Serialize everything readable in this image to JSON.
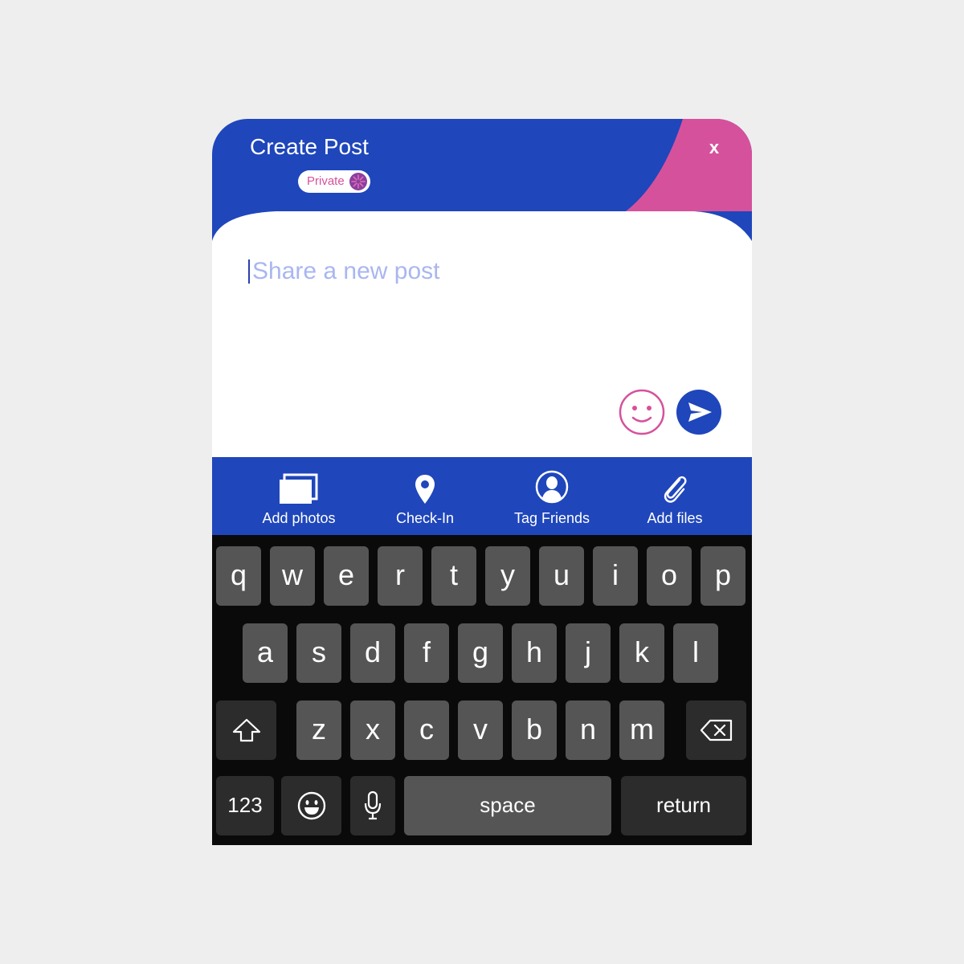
{
  "header": {
    "title": "Create Post",
    "close_label": "x",
    "privacy_label": "Private"
  },
  "composer": {
    "placeholder": "Share a new post",
    "value": ""
  },
  "toolbar": {
    "items": [
      {
        "label": "Add photos",
        "icon": "photos-icon"
      },
      {
        "label": "Check-In",
        "icon": "location-pin-icon"
      },
      {
        "label": "Tag Friends",
        "icon": "person-icon"
      },
      {
        "label": "Add files",
        "icon": "paperclip-icon"
      }
    ]
  },
  "keyboard": {
    "row1": [
      "q",
      "w",
      "e",
      "r",
      "t",
      "y",
      "u",
      "i",
      "o",
      "p"
    ],
    "row2": [
      "a",
      "s",
      "d",
      "f",
      "g",
      "h",
      "j",
      "k",
      "l"
    ],
    "row3": [
      "z",
      "x",
      "c",
      "v",
      "b",
      "n",
      "m"
    ],
    "numbers_label": "123",
    "space_label": "space",
    "return_label": "return"
  },
  "colors": {
    "primary": "#1f46bb",
    "accent": "#d6519c",
    "placeholder": "#a9b6f0",
    "key": "#555555",
    "key_dark": "#2c2c2c",
    "keyboard_bg": "#0a0a0a"
  }
}
